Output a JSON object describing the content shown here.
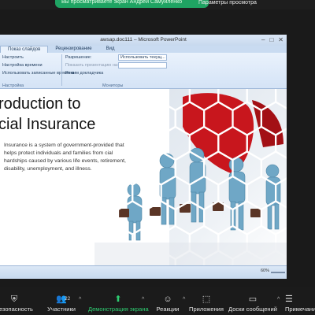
{
  "zoom_top": {
    "share_text": "Вы просматриваете экран Андрей Самуйленко",
    "view_options": "Параметры просмотра"
  },
  "window": {
    "title": "awsap.doc111 – Microsoft PowerPoint",
    "controls": [
      "–",
      "□",
      "✕"
    ]
  },
  "ribbon": {
    "tabs": [
      "Показ слайдов",
      "Рецензирование",
      "Вид"
    ],
    "active_tab": "Показ слайдов",
    "group1": {
      "items": [
        "Настроить",
        "Настройка времени",
        "Использовать записанные времена"
      ],
      "label": "Настройка"
    },
    "group2": {
      "resolution_label": "Разрешение:",
      "resolution_value": "Использовать текущ...",
      "show_on_label": "Показать презентацию на:",
      "presenter_mode": "Режим докладчика",
      "label": "Мониторы"
    }
  },
  "slide": {
    "title_line1": "roduction to",
    "title_line2": "cial Insurance",
    "body": "Insurance is a system of government-provided that helps protect individuals and families from cial hardships caused by various life events, retirement, disability, unemployment, and illness."
  },
  "statusbar": {
    "zoom": "60%"
  },
  "toolbar": {
    "security": "Безопасность",
    "participants": "Участники",
    "participants_count": "22",
    "share": "Демонстрация экрана",
    "reactions": "Реакции",
    "apps": "Приложения",
    "notes": "Доски сообщений",
    "notes_short": "Примечания"
  },
  "colors": {
    "share_green": "#1fa463",
    "red_accent": "#c8161d",
    "figure_blue": "#6fa7c6"
  }
}
